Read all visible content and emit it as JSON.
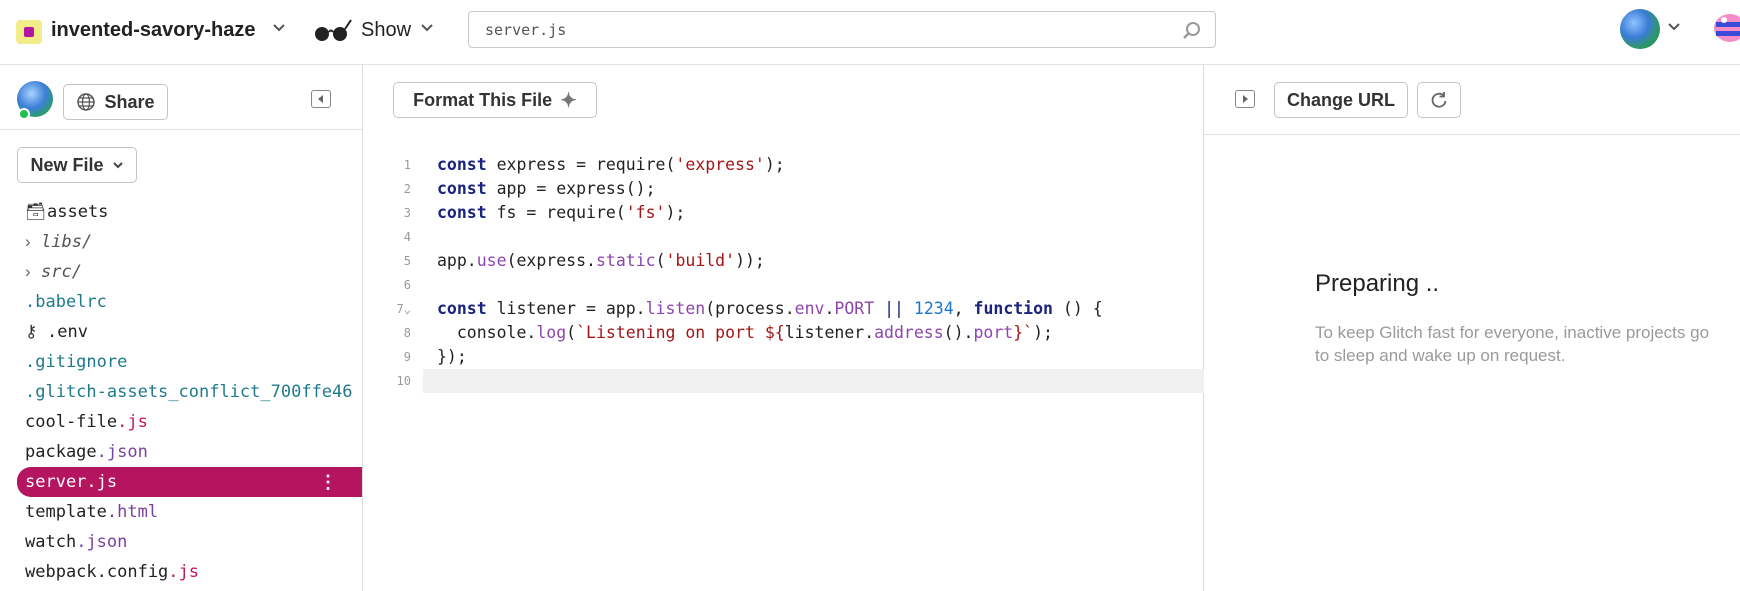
{
  "header": {
    "project_name": "invented-savory-haze",
    "show_label": "Show",
    "search_value": "server.js",
    "colors": {
      "project_icon_bg": "#f3ec8a",
      "project_icon_fg": "#b5179e"
    },
    "icons": [
      "project-icon",
      "chevron-down-icon",
      "glasses-icon",
      "search-icon",
      "avatar",
      "glitch-logo"
    ]
  },
  "sidebar": {
    "share_label": "Share",
    "new_file_label": "New File",
    "selected_color": "#b5145e",
    "files": [
      {
        "kind": "folder-static",
        "icon": "archive-icon",
        "name": "assets"
      },
      {
        "kind": "folder",
        "name": "libs/"
      },
      {
        "kind": "folder",
        "name": "src/"
      },
      {
        "kind": "dotfile",
        "name": ".babelrc"
      },
      {
        "kind": "env",
        "icon": "key-icon",
        "name": ".env"
      },
      {
        "kind": "dotfile",
        "name": ".gitignore"
      },
      {
        "kind": "dotfile",
        "name": ".glitch-assets_conflict_700ffe46"
      },
      {
        "kind": "file",
        "base": "cool-file",
        "ext": ".js"
      },
      {
        "kind": "file",
        "base": "package",
        "ext": ".json"
      },
      {
        "kind": "file",
        "base": "server",
        "ext": ".js",
        "selected": true
      },
      {
        "kind": "file",
        "base": "template",
        "ext": ".html"
      },
      {
        "kind": "file",
        "base": "watch",
        "ext": ".json"
      },
      {
        "kind": "file",
        "base": "webpack.config",
        "ext": ".js"
      }
    ]
  },
  "editor": {
    "format_label": "Format This File",
    "lines": [
      {
        "n": "1",
        "tokens": [
          [
            "kw",
            "const"
          ],
          [
            "t",
            " express = require("
          ],
          [
            "str",
            "'express'"
          ],
          [
            "t",
            ");"
          ]
        ]
      },
      {
        "n": "2",
        "tokens": [
          [
            "kw",
            "const"
          ],
          [
            "t",
            " app = express();"
          ]
        ]
      },
      {
        "n": "3",
        "tokens": [
          [
            "kw",
            "const"
          ],
          [
            "t",
            " fs = require("
          ],
          [
            "str",
            "'fs'"
          ],
          [
            "t",
            ");"
          ]
        ]
      },
      {
        "n": "4",
        "tokens": []
      },
      {
        "n": "5",
        "tokens": [
          [
            "t",
            "app."
          ],
          [
            "fn",
            "use"
          ],
          [
            "t",
            "(express."
          ],
          [
            "fn",
            "static"
          ],
          [
            "t",
            "("
          ],
          [
            "str",
            "'build'"
          ],
          [
            "t",
            "));"
          ]
        ]
      },
      {
        "n": "6",
        "tokens": []
      },
      {
        "n": "7",
        "fold": true,
        "tokens": [
          [
            "kw",
            "const"
          ],
          [
            "t",
            " listener = app."
          ],
          [
            "fn",
            "listen"
          ],
          [
            "t",
            "(process."
          ],
          [
            "fn",
            "env"
          ],
          [
            "t",
            "."
          ],
          [
            "fn",
            "PORT"
          ],
          [
            "t",
            " "
          ],
          [
            "op",
            "||"
          ],
          [
            "t",
            " "
          ],
          [
            "num",
            "1234"
          ],
          [
            "t",
            ", "
          ],
          [
            "kw",
            "function"
          ],
          [
            "t",
            " () {"
          ]
        ]
      },
      {
        "n": "8",
        "tokens": [
          [
            "t",
            "  console."
          ],
          [
            "fn",
            "log"
          ],
          [
            "t",
            "("
          ],
          [
            "tpl",
            "`Listening on port ${"
          ],
          [
            "t",
            "listener."
          ],
          [
            "fn",
            "address"
          ],
          [
            "t",
            "()."
          ],
          [
            "fn",
            "port"
          ],
          [
            "tpl",
            "}`"
          ],
          [
            "t",
            ");"
          ]
        ]
      },
      {
        "n": "9",
        "tokens": [
          [
            "t",
            "});"
          ]
        ]
      },
      {
        "n": "10",
        "active": true,
        "tokens": []
      }
    ]
  },
  "preview": {
    "change_url_label": "Change URL",
    "title": "Preparing ..",
    "message": "To keep Glitch fast for everyone, inactive projects go to sleep and wake up on request."
  }
}
